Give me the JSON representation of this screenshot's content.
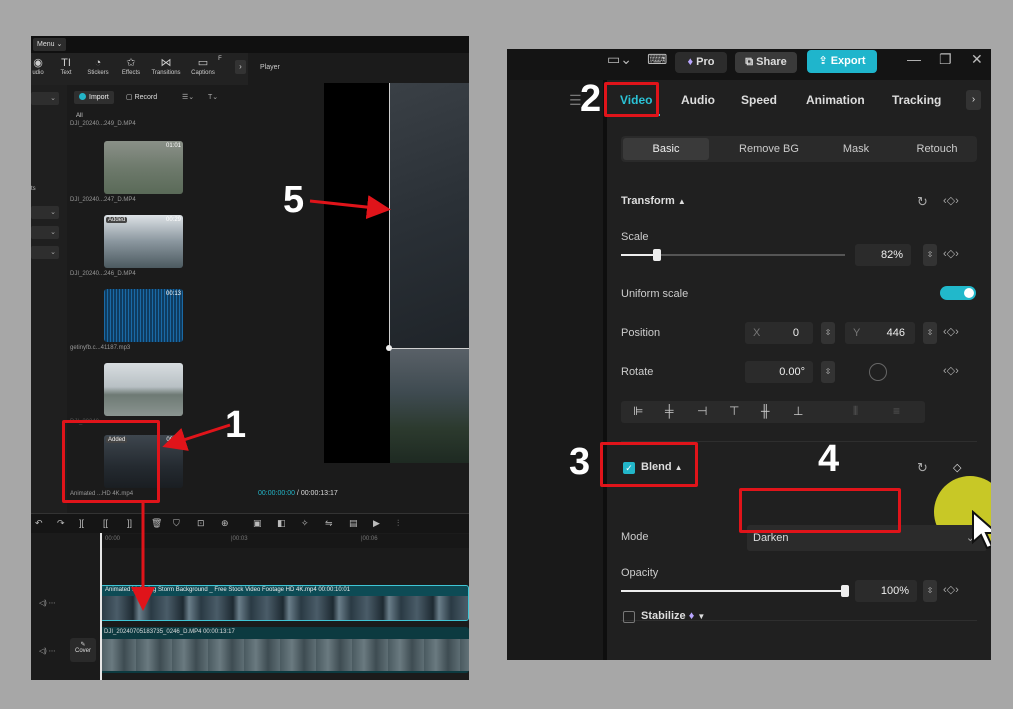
{
  "left": {
    "menu_label": "Menu ⌄",
    "tools": [
      {
        "icon": "audio-icon",
        "label": "udio",
        "glyph": "◉"
      },
      {
        "icon": "text-icon",
        "label": "Text",
        "glyph": "TI"
      },
      {
        "icon": "stickers-icon",
        "label": "Stickers",
        "glyph": "◔"
      },
      {
        "icon": "effects-icon",
        "label": "Effects",
        "glyph": "✩"
      },
      {
        "icon": "transitions-icon",
        "label": "Transitions",
        "glyph": "⋈"
      },
      {
        "icon": "captions-icon",
        "label": "Captions",
        "glyph": "▭"
      },
      {
        "icon": "more-icon",
        "label": "F",
        "glyph": ""
      }
    ],
    "side_label": "ts",
    "import_label": "Import",
    "record_label": "Record",
    "all_label": "All",
    "media": [
      {
        "name": "DJI_20240...249_D.MP4",
        "duration": "",
        "added": false
      },
      {
        "name": "DJI_20240...247_D.MP4",
        "duration": "01:01",
        "added": false
      },
      {
        "name": "DJI_20240...246_D.MP4",
        "duration": "00:29",
        "added": true
      },
      {
        "name": "getinyfb.c...41187.mp3",
        "duration": "00:13",
        "added": false
      },
      {
        "name": "DJI_20240...",
        "duration": "",
        "added": false
      },
      {
        "name": "Animated ...HD 4K.mp4",
        "duration": "00:11",
        "added": true
      }
    ],
    "added_badge": "Added",
    "player_title": "Player",
    "timecode_current": "00:00:00:00",
    "timecode_sep": " / ",
    "timecode_total": "00:00:13:17",
    "ruler_ticks": [
      "00:00",
      "|00:03",
      "|00:06"
    ],
    "track1_label": "Animated Lightning Storm Background _ Free Stock Video Footage HD 4K.mp4   00:00:10:01",
    "track2_label": "DJI_20240705183735_0246_D.MP4   00:00:13:17",
    "cover_label": "Cover"
  },
  "right": {
    "pro_label": "Pro",
    "share_label": "Share",
    "export_label": "Export",
    "tabs": [
      "Video",
      "Audio",
      "Speed",
      "Animation",
      "Tracking"
    ],
    "subtabs": [
      "Basic",
      "Remove BG",
      "Mask",
      "Retouch"
    ],
    "transform_label": "Transform",
    "scale_label": "Scale",
    "scale_value": "82%",
    "scale_fraction": 0.82,
    "uniform_label": "Uniform scale",
    "uniform_on": true,
    "position_label": "Position",
    "pos_x_label": "X",
    "pos_x": "0",
    "pos_y_label": "Y",
    "pos_y": "446",
    "rotate_label": "Rotate",
    "rotate_value": "0.00°",
    "blend_label": "Blend",
    "mode_label": "Mode",
    "mode_value": "Darken",
    "opacity_label": "Opacity",
    "opacity_value": "100%",
    "opacity_fraction": 1.0,
    "stabilize_label": "Stabilize"
  },
  "annotations": {
    "n1": "1",
    "n2": "2",
    "n3": "3",
    "n4": "4",
    "n5": "5",
    "highlight_color": "#e0141a"
  },
  "colors": {
    "accent": "#23b5c8",
    "background": "#a7a7a7"
  }
}
